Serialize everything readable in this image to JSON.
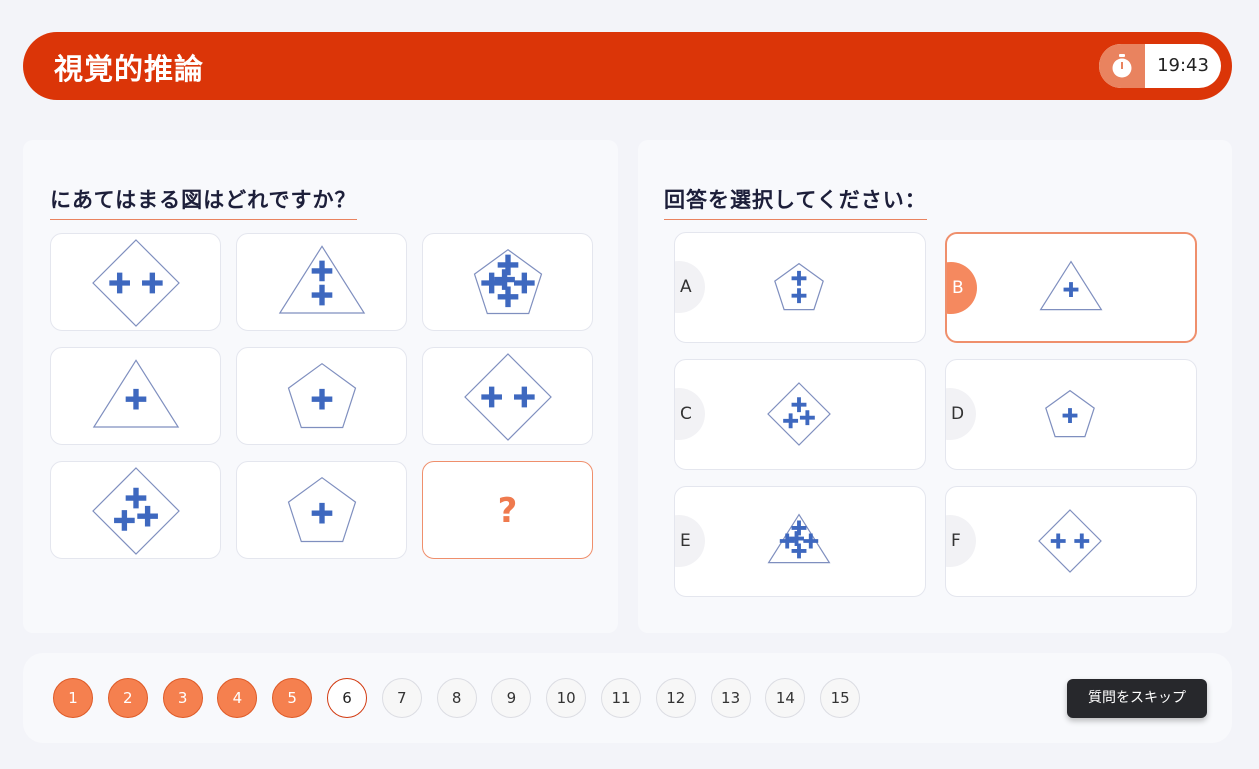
{
  "header": {
    "title": "視覚的推論",
    "timer": "19:43"
  },
  "question": {
    "heading": "にあてはまる図はどれですか？",
    "missing_symbol": "?",
    "grid": [
      {
        "shape": "diamond",
        "crosses": 2
      },
      {
        "shape": "triangle",
        "crosses": 2
      },
      {
        "shape": "pentagon",
        "crosses": 5
      },
      {
        "shape": "triangle",
        "crosses": 1
      },
      {
        "shape": "pentagon",
        "crosses": 1
      },
      {
        "shape": "diamond",
        "crosses": 2
      },
      {
        "shape": "diamond",
        "crosses": 3
      },
      {
        "shape": "pentagon",
        "crosses": 1
      },
      {
        "shape": "missing",
        "crosses": 0
      }
    ]
  },
  "answers": {
    "heading": "回答を選択してください：",
    "selected": "B",
    "options": [
      {
        "letter": "A",
        "shape": "pentagon",
        "crosses": 2
      },
      {
        "letter": "B",
        "shape": "triangle",
        "crosses": 1
      },
      {
        "letter": "C",
        "shape": "diamond",
        "crosses": 3
      },
      {
        "letter": "D",
        "shape": "pentagon",
        "crosses": 1
      },
      {
        "letter": "E",
        "shape": "triangle",
        "crosses": 5
      },
      {
        "letter": "F",
        "shape": "diamond",
        "crosses": 2
      }
    ]
  },
  "pagination": {
    "pages": [
      "1",
      "2",
      "3",
      "4",
      "5",
      "6",
      "7",
      "8",
      "9",
      "10",
      "11",
      "12",
      "13",
      "14",
      "15"
    ],
    "completed": [
      "1",
      "2",
      "3",
      "4",
      "5"
    ],
    "current": "6"
  },
  "skip_label": "質問をスキップ",
  "colors": {
    "header": "#db3508",
    "accent": "#f5804f",
    "cross": "#3e68bf",
    "outline": "#7f8fbf"
  }
}
